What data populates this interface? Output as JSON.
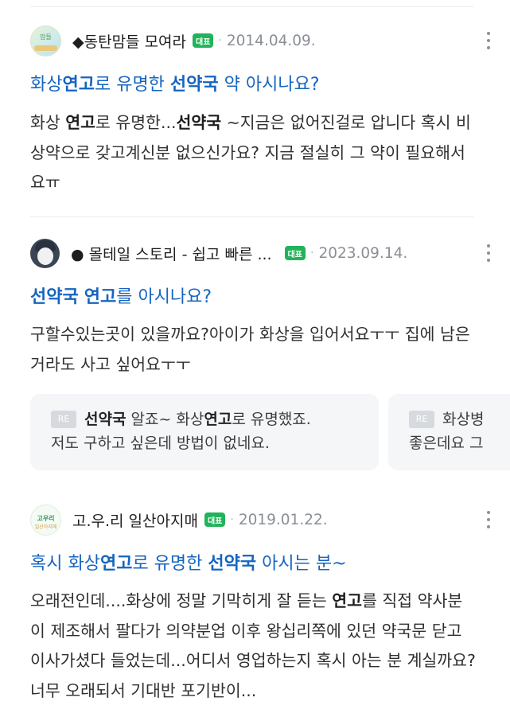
{
  "posts": [
    {
      "cafe": "◆동탄맘들 모여라",
      "avatar_text": "맘들",
      "badge": "대표",
      "dot": "·",
      "date": "2014.04.09.",
      "title": [
        {
          "t": "화상"
        },
        {
          "t": "연고",
          "b": true
        },
        {
          "t": "로 유명한 "
        },
        {
          "t": "선약국",
          "b": true
        },
        {
          "t": " 약 아시나요?"
        }
      ],
      "snippet": [
        {
          "t": "화상 "
        },
        {
          "t": "연고",
          "b": true
        },
        {
          "t": "로 유명한..."
        },
        {
          "t": "선약국",
          "b": true
        },
        {
          "t": " ~지금은 없어진걸로 압니다 혹시 비상약으로 갖고계신분 없으신가요? 지금 절실히 그 약이 필요해서요ㅠ"
        }
      ]
    },
    {
      "cafe": "● 몰테일 스토리 - 쉽고 빠른 ...",
      "badge": "대표",
      "dot": "·",
      "date": "2023.09.14.",
      "title": [
        {
          "t": "선약국",
          "b": true
        },
        {
          "t": " "
        },
        {
          "t": "연고",
          "b": true
        },
        {
          "t": "를 아시나요?"
        }
      ],
      "snippet": [
        {
          "t": "구할수있는곳이 있을까요?아이가 화상을 입어서요ㅜㅜ 집에 남은거라도 사고 싶어요ㅜㅜ"
        }
      ]
    },
    {
      "cafe": "고.우.리 일산아지매",
      "avatar_text": "고우리",
      "avatar_sub": "일산아지매",
      "badge": "대표",
      "dot": "·",
      "date": "2019.01.22.",
      "title": [
        {
          "t": "혹시 화상"
        },
        {
          "t": "연고",
          "b": true
        },
        {
          "t": "로 유명한 "
        },
        {
          "t": "선약국",
          "b": true
        },
        {
          "t": " 아시는 분~"
        }
      ],
      "snippet": [
        {
          "t": "오래전인데....화상에 정말 기막히게 잘 듣는 "
        },
        {
          "t": "연고",
          "b": true
        },
        {
          "t": "를 직접 약사분이 제조해서 팔다가 의약분업 이후 왕십리쪽에 있던 약국문 닫고 이사가셨다 들었는데...어디서 영업하는지 혹시 아는 분 계실까요? 너무 오래되서 기대반 포기반이..."
        }
      ]
    }
  ],
  "replies": [
    {
      "badge": "RE",
      "line1": [
        {
          "t": "선약국",
          "b": true
        },
        {
          "t": " 알죠~ 화상"
        },
        {
          "t": "연고",
          "b": true
        },
        {
          "t": "로 유명했죠."
        }
      ],
      "line2": "저도 구하고 싶은데 방법이 없네요."
    },
    {
      "badge": "RE",
      "line1": [
        {
          "t": "화상병"
        }
      ],
      "line2": "좋은데요 그"
    }
  ]
}
